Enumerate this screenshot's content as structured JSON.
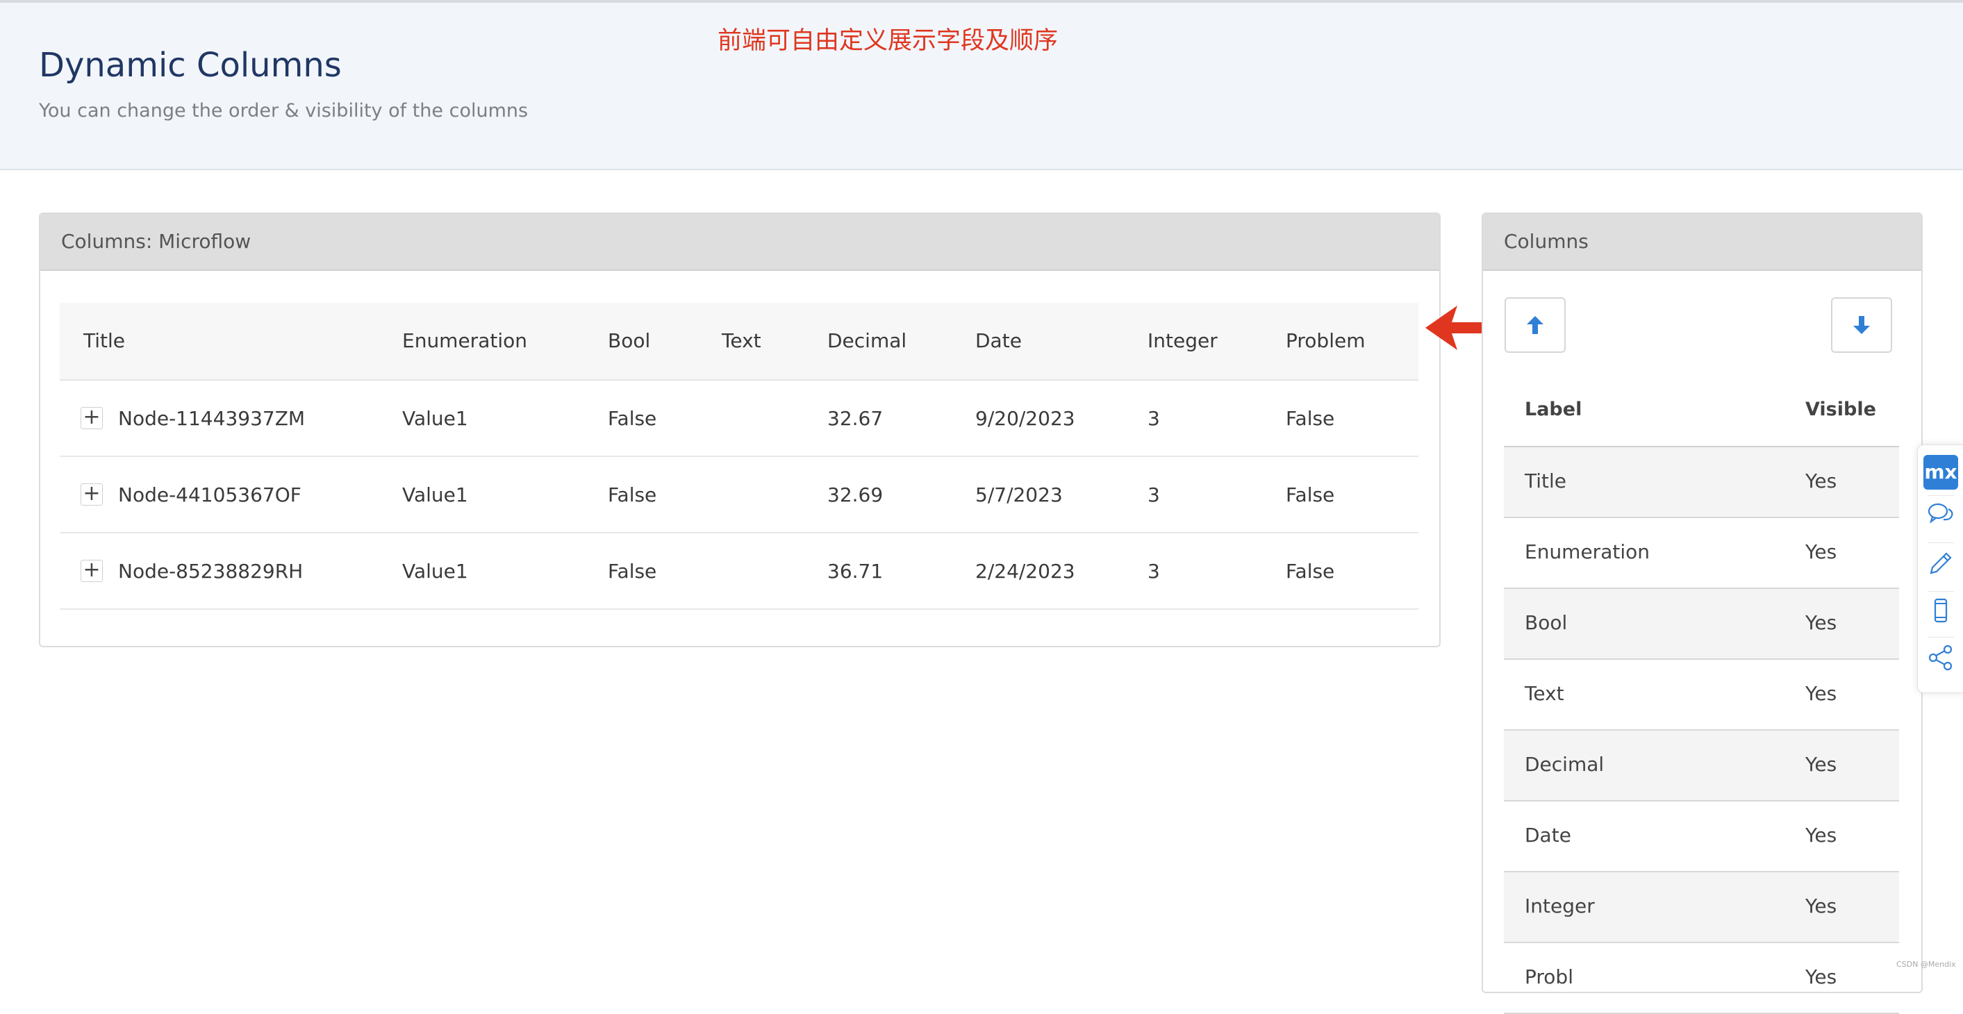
{
  "header": {
    "title": "Dynamic Columns",
    "subtitle": "You can change the order & visibility of the columns",
    "annotation": "前端可自由定义展示字段及顺序"
  },
  "main_panel": {
    "title": "Columns: Microflow",
    "columns": [
      "Title",
      "Enumeration",
      "Bool",
      "Text",
      "Decimal",
      "Date",
      "Integer",
      "Problem"
    ],
    "rows": [
      {
        "title": "Node-11443937ZM",
        "enumeration": "Value1",
        "bool": "False",
        "text": "",
        "decimal": "32.67",
        "date": "9/20/2023",
        "integer": "3",
        "problem": "False"
      },
      {
        "title": "Node-44105367OF",
        "enumeration": "Value1",
        "bool": "False",
        "text": "",
        "decimal": "32.69",
        "date": "5/7/2023",
        "integer": "3",
        "problem": "False"
      },
      {
        "title": "Node-85238829RH",
        "enumeration": "Value1",
        "bool": "False",
        "text": "",
        "decimal": "36.71",
        "date": "2/24/2023",
        "integer": "3",
        "problem": "False"
      }
    ],
    "expand_glyph": "+"
  },
  "side_panel": {
    "title": "Columns",
    "move_up_icon": "arrow-up-icon",
    "move_down_icon": "arrow-down-icon",
    "label_header": "Label",
    "visible_header": "Visible",
    "rows": [
      {
        "label": "Title",
        "visible": "Yes"
      },
      {
        "label": "Enumeration",
        "visible": "Yes"
      },
      {
        "label": "Bool",
        "visible": "Yes"
      },
      {
        "label": "Text",
        "visible": "Yes"
      },
      {
        "label": "Decimal",
        "visible": "Yes"
      },
      {
        "label": "Date",
        "visible": "Yes"
      },
      {
        "label": "Integer",
        "visible": "Yes"
      },
      {
        "label": "Probl",
        "visible": "Yes"
      }
    ]
  },
  "toolbar": {
    "logo": "mx",
    "icons": [
      "chat-icon",
      "edit-icon",
      "mobile-icon",
      "share-icon"
    ]
  },
  "watermark": "CSDN @Mendix",
  "colors": {
    "accent": "#2f7fd6",
    "annotation": "#e0361f",
    "title": "#203764"
  }
}
